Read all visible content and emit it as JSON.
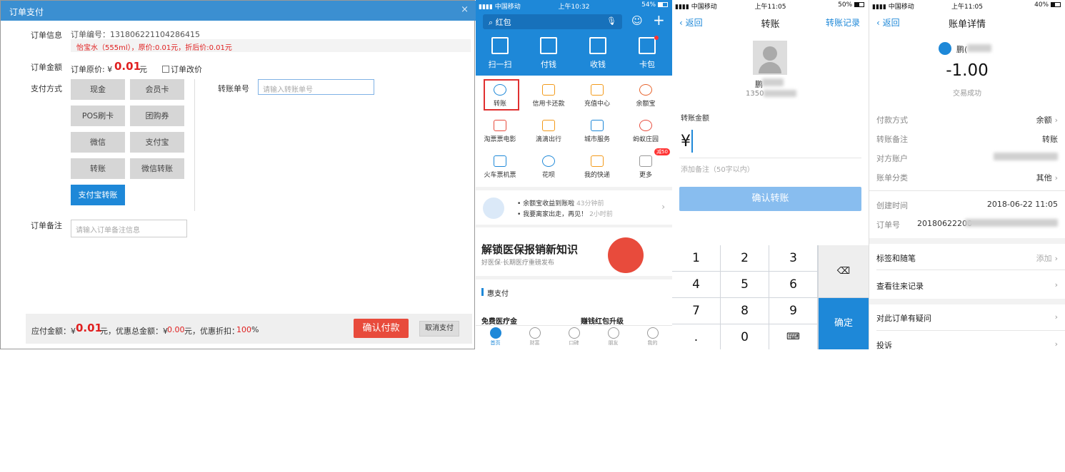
{
  "dialog": {
    "title": "订单支付",
    "close_glyph": "×",
    "order_info_label": "订单信息",
    "order_no": "订单编号：131806221104286415",
    "item_line": "怡宝水（555ml），原价:0.01元，折后价:0.01元",
    "order_amount_label": "订单金额",
    "original_price_prefix": "订单原价: ¥",
    "original_price_value": "0.01",
    "original_price_unit": "元",
    "change_price_label": "订单改价",
    "pay_method_label": "支付方式",
    "pay_methods": [
      "现金",
      "会员卡",
      "POS刷卡",
      "团购券",
      "微信",
      "支付宝",
      "转账",
      "微信转账"
    ],
    "selected_method": "支付宝转账",
    "transfer_no_label": "转账单号",
    "transfer_no_placeholder": "请输入转账单号",
    "remark_label": "订单备注",
    "remark_placeholder": "请输入订单备注信息",
    "footer": {
      "payable_label": "应付金额：¥",
      "payable_value": "0.01",
      "payable_unit": "元，优惠总金额：¥",
      "discount_total": "0.00",
      "discount_rate_label": "元，优惠折扣：",
      "discount_rate": "100",
      "discount_rate_unit": "%",
      "confirm": "确认付款",
      "cancel": "取消支付"
    }
  },
  "phone_home": {
    "status": {
      "carrier": "中国移动",
      "time": "上午10:32",
      "battery": "54%",
      "battery_level": 0.54
    },
    "search_placeholder": "红包",
    "top_actions": [
      "扫一扫",
      "付钱",
      "收钱",
      "卡包"
    ],
    "grid": [
      "转账",
      "信用卡还款",
      "充值中心",
      "余额宝",
      "淘票票电影",
      "滴滴出行",
      "城市服务",
      "蚂蚁庄园",
      "火车票机票",
      "花呗",
      "我的快递",
      "更多"
    ],
    "more_badge": "减50",
    "news": [
      {
        "text": "余额宝收益到账啦",
        "time": "43分钟前"
      },
      {
        "text": "我要离家出走，再见！",
        "time": "2小时前"
      }
    ],
    "banner_title": "解锁医保报销新知识",
    "banner_sub": "好医保·长期医疗重磅发布",
    "section_title": "惠支付",
    "card_left": "免费医疗金",
    "card_right": "赚钱红包升级",
    "tabs": [
      "首页",
      "财富",
      "口碑",
      "朋友",
      "我的"
    ]
  },
  "transfer": {
    "status": {
      "carrier": "中国移动",
      "time": "上午11:05",
      "battery": "50%",
      "battery_level": 0.5
    },
    "back": "返回",
    "title": "转账",
    "right": "转账记录",
    "name_partial": "鹏",
    "phone_partial": "1350",
    "amount_label": "转账金额",
    "currency": "¥",
    "remark_placeholder": "添加备注（50字以内）",
    "confirm": "确认转账",
    "keys": [
      "1",
      "2",
      "3",
      "4",
      "5",
      "6",
      "7",
      "8",
      "9",
      ".",
      "0"
    ],
    "done": "确定"
  },
  "bill": {
    "status": {
      "carrier": "中国移动",
      "time": "上午11:05",
      "battery": "40%",
      "battery_level": 0.4
    },
    "back": "返回",
    "title": "账单详情",
    "name_partial": "鹏(",
    "amount": "-1.00",
    "state": "交易成功",
    "rows1": [
      {
        "k": "付款方式",
        "v": "余额",
        "chev": true
      },
      {
        "k": "转账备注",
        "v": "转账",
        "chev": false
      },
      {
        "k": "对方账户",
        "v": "",
        "chev": false
      },
      {
        "k": "账单分类",
        "v": "其他",
        "chev": true
      }
    ],
    "created_label": "创建时间",
    "created_value": "2018-06-22 11:05",
    "order_label": "订单号",
    "order_value": "20180622200",
    "tags_label": "标签和随笔",
    "tags_action": "添加",
    "history": "查看往来记录",
    "dispute": "对此订单有疑问",
    "complain": "投诉"
  }
}
